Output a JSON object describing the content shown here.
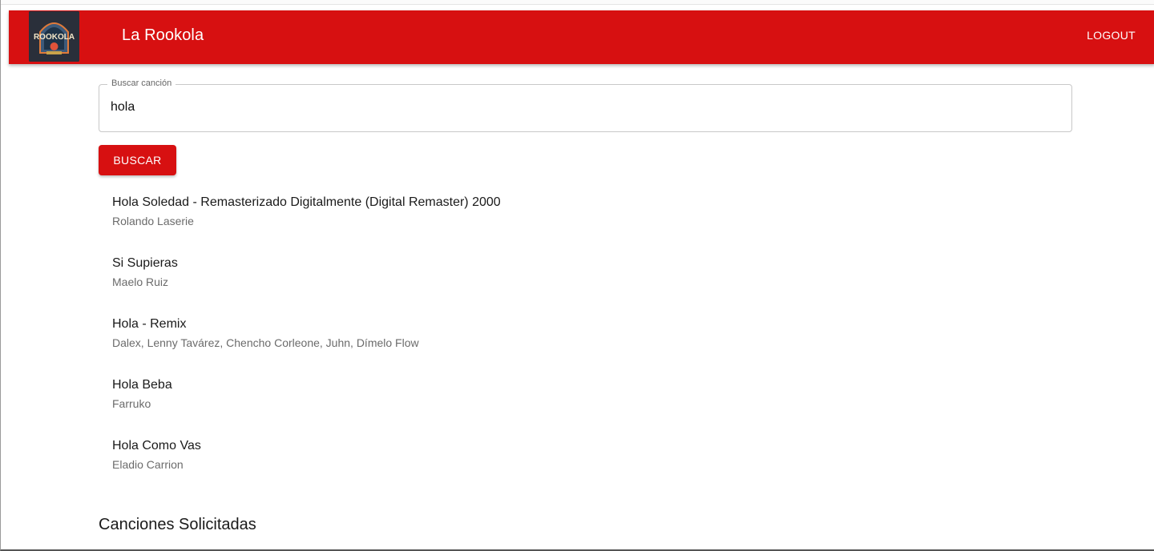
{
  "app": {
    "title": "La Rookola",
    "logo_text": "ROOKOLA",
    "logout_label": "LOGOUT",
    "brand_color": "#d71011"
  },
  "search": {
    "label": "Buscar canción",
    "value": "hola",
    "button_label": "BUSCAR"
  },
  "results": [
    {
      "title": "Hola Soledad - Remasterizado Digitalmente (Digital Remaster) 2000",
      "artist": "Rolando Laserie"
    },
    {
      "title": "Si Supieras",
      "artist": "Maelo Ruiz"
    },
    {
      "title": "Hola - Remix",
      "artist": "Dalex, Lenny Tavárez, Chencho Corleone, Juhn, Dímelo Flow"
    },
    {
      "title": "Hola Beba",
      "artist": "Farruko"
    },
    {
      "title": "Hola Como Vas",
      "artist": "Eladio Carrion"
    }
  ],
  "requested": {
    "heading": "Canciones Solicitadas"
  }
}
